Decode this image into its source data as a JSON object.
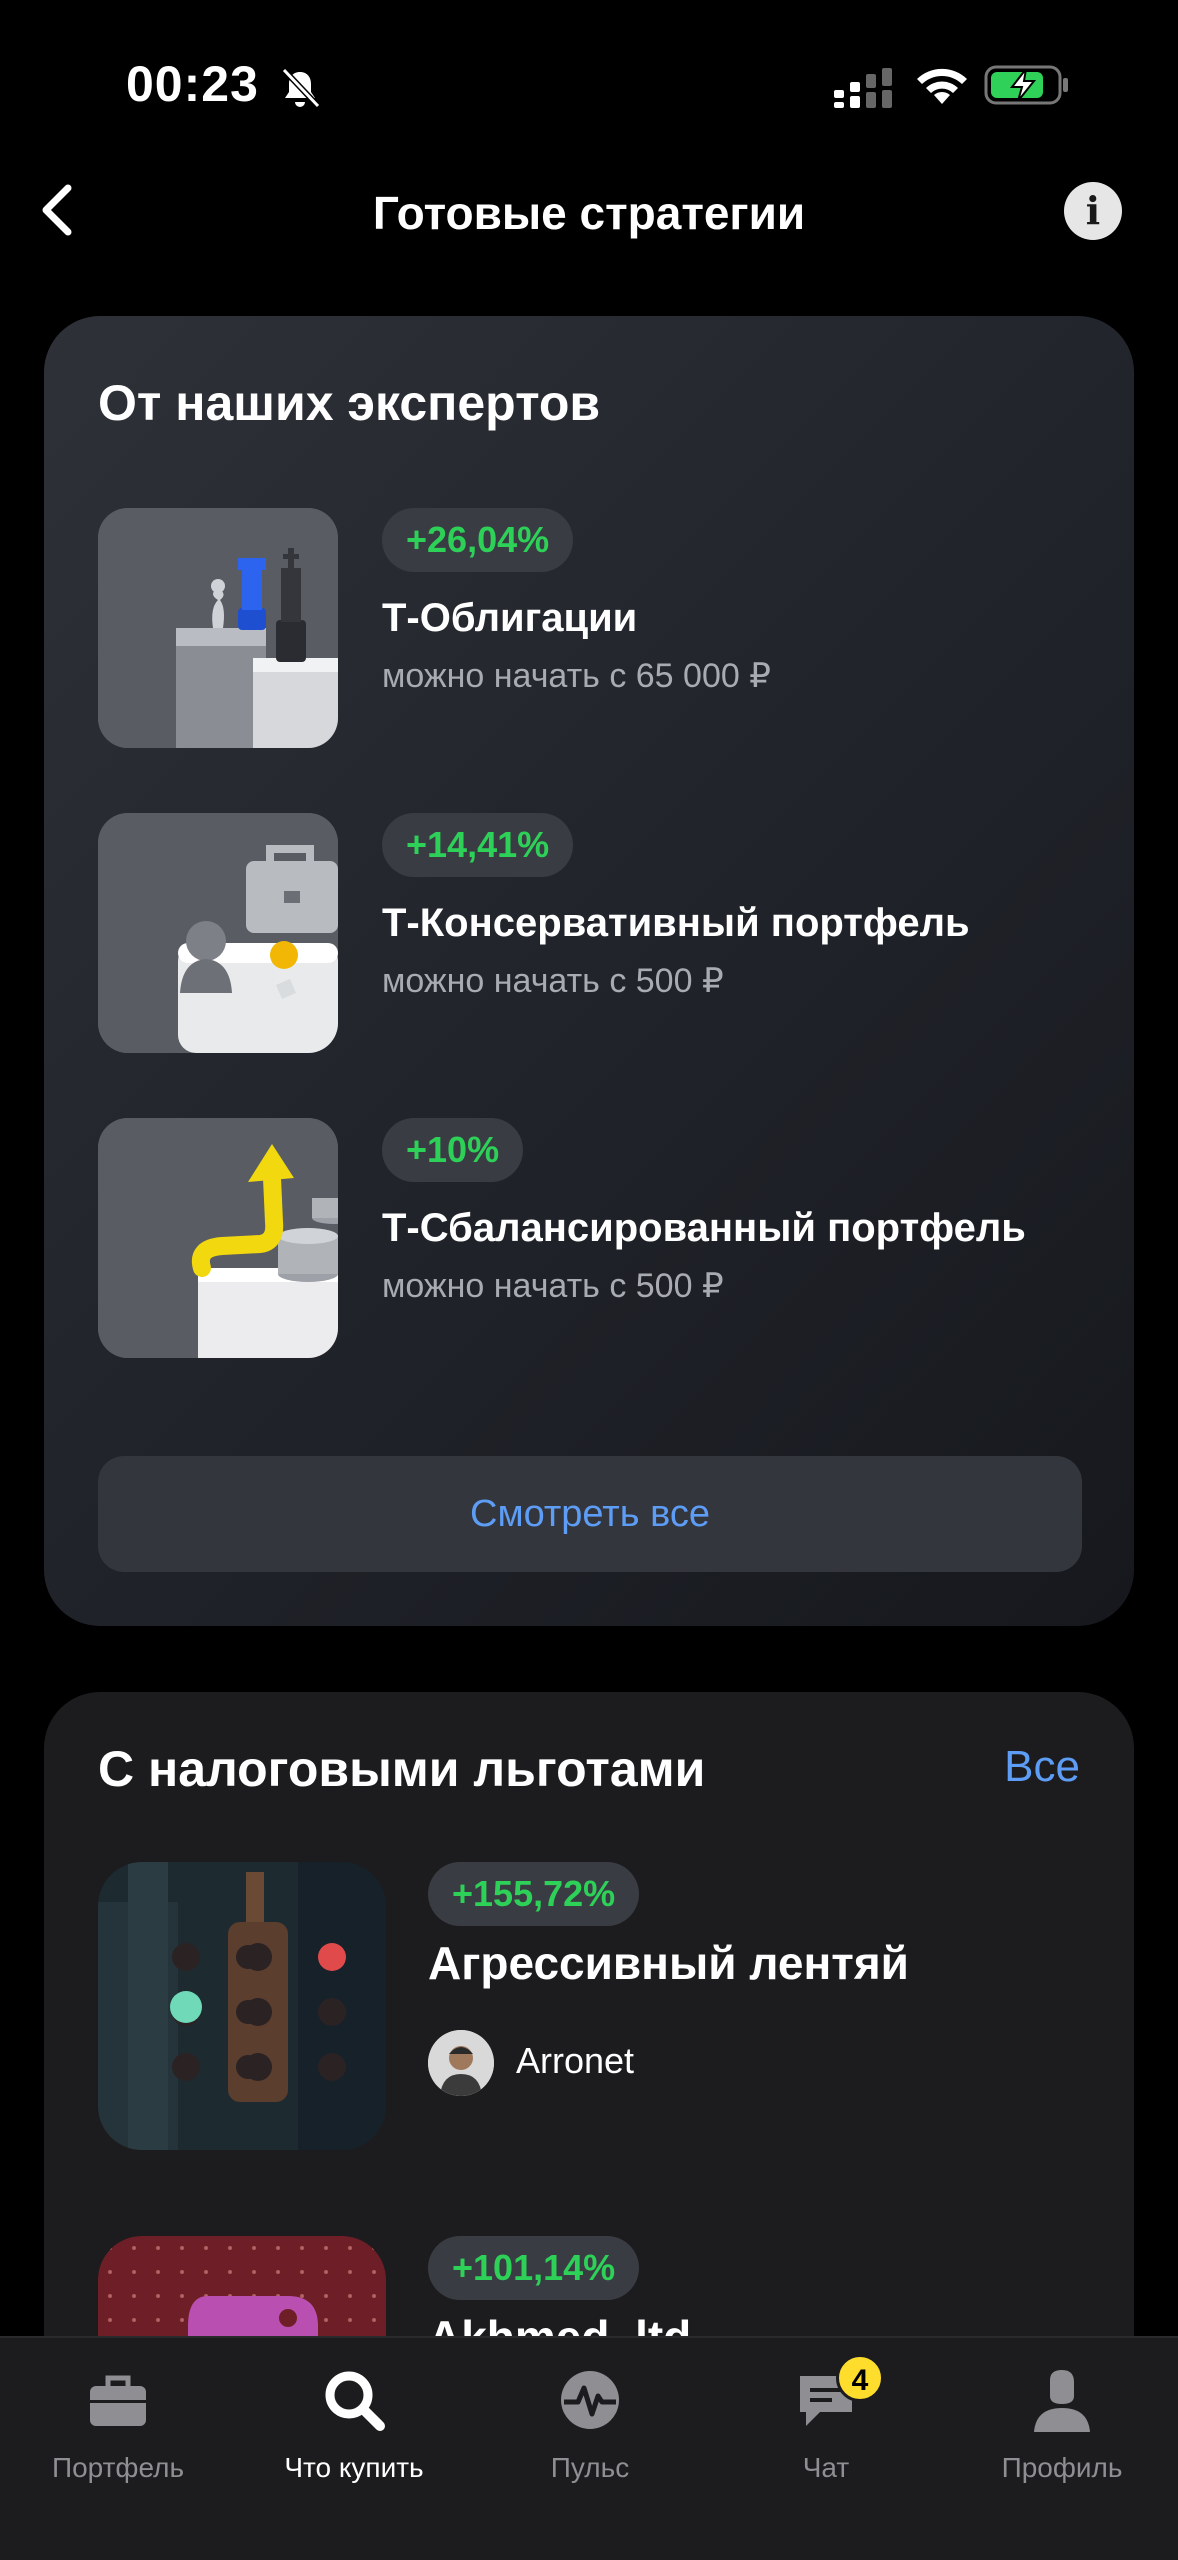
{
  "status_bar": {
    "time": "00:23",
    "battery_color": "#30d158"
  },
  "header": {
    "title": "Готовые стратегии"
  },
  "experts": {
    "title": "От наших экспертов",
    "items": [
      {
        "percent": "+26,04%",
        "name": "Т-Облигации",
        "subtitle": "можно начать с 65 000 ₽",
        "icon": "chess-pieces-image"
      },
      {
        "percent": "+14,41%",
        "name": "Т-Консервативный портфель",
        "subtitle": "можно начать с 500 ₽",
        "icon": "briefcase-image"
      },
      {
        "percent": "+10%",
        "name": "Т-Сбалансированный портфель",
        "subtitle": "можно начать с 500 ₽",
        "icon": "arrow-coins-image"
      }
    ],
    "see_all": "Смотреть все"
  },
  "tax": {
    "title": "С налоговыми льготами",
    "all_link": "Все",
    "items": [
      {
        "percent": "+155,72%",
        "name": "Агрессивный лентяй",
        "author": "Arronet"
      },
      {
        "percent": "+101,14%",
        "name": "Akhmed_ltd"
      }
    ]
  },
  "tabs": [
    {
      "label": "Портфель",
      "icon": "briefcase-icon",
      "active": false
    },
    {
      "label": "Что купить",
      "icon": "search-icon",
      "active": true
    },
    {
      "label": "Пульс",
      "icon": "pulse-icon",
      "active": false
    },
    {
      "label": "Чат",
      "icon": "chat-icon",
      "active": false,
      "badge": "4"
    },
    {
      "label": "Профиль",
      "icon": "profile-icon",
      "active": false
    }
  ],
  "colors": {
    "positive": "#2ed158",
    "link": "#5d9df5",
    "badge": "#ffdd2d"
  }
}
